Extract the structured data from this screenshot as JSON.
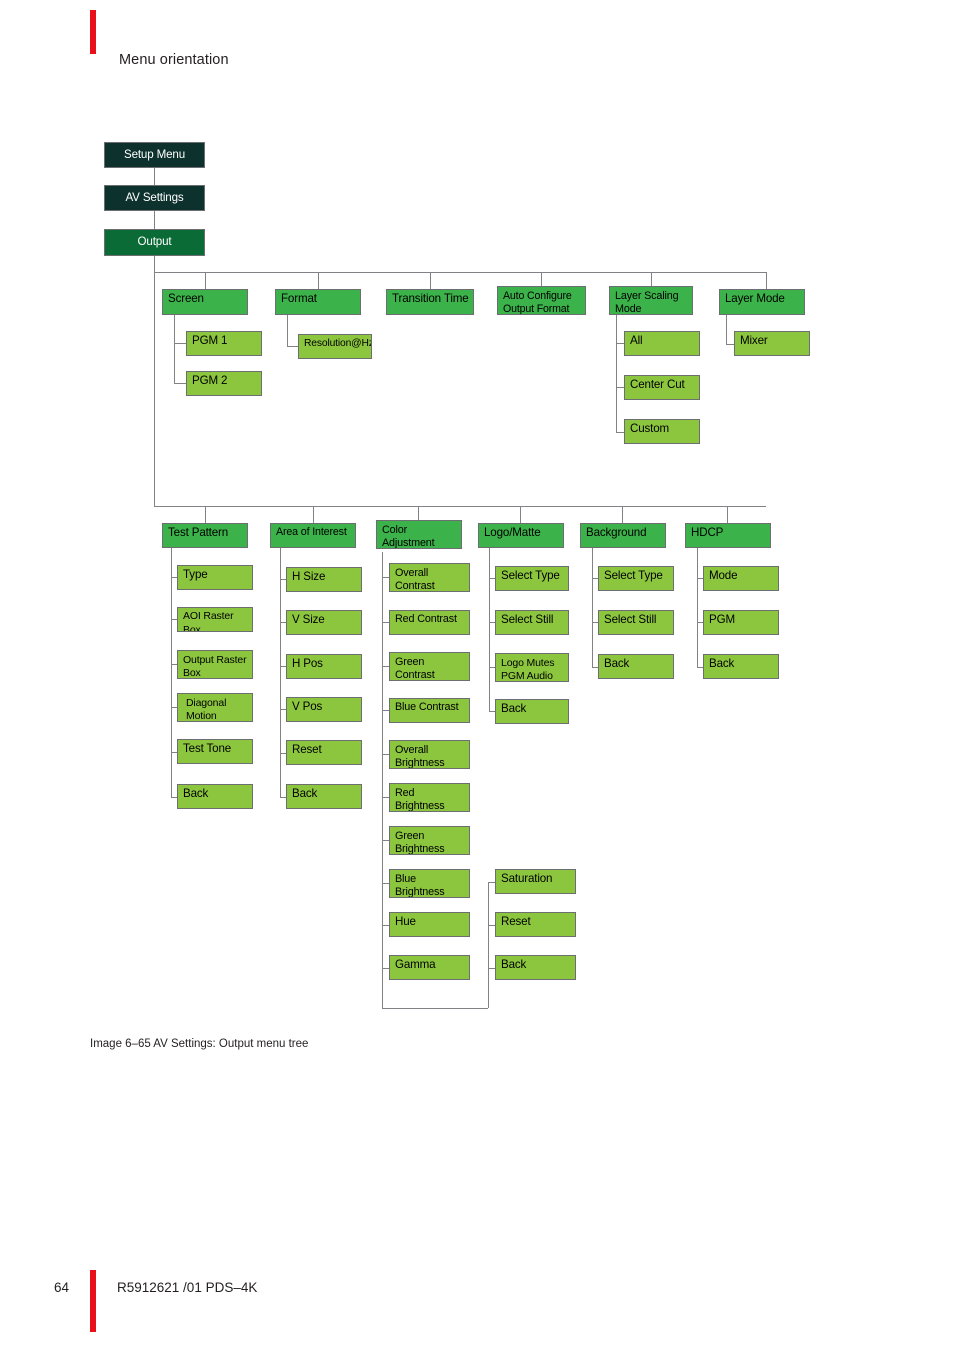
{
  "page": {
    "header_title": "Menu orientation",
    "figure_caption": "Image 6–65  AV Settings: Output menu tree",
    "footer_page_number": "64",
    "footer_document": "R5912621 /01  PDS–4K",
    "accent_color": "#e8111a"
  },
  "palette": {
    "dark": "#0d322e",
    "deep": "#0a6b36",
    "mid": "#3cb24a",
    "light": "#8cc63f",
    "line": "#808285",
    "border": "#6d6e71"
  },
  "nodes": {
    "setup_menu": "Setup Menu",
    "av_settings": "AV Settings",
    "output": "Output",
    "screen": "Screen",
    "pgm1": "PGM 1",
    "pgm2": "PGM 2",
    "format": "Format",
    "resolution": "Resolution@Hz",
    "transition_time": "Transition Time",
    "auto_configure": "Auto Configure\nOutput Format",
    "layer_scaling_mode": "Layer Scaling\nMode",
    "all": "All",
    "center_cut": "Center Cut",
    "custom": "Custom",
    "layer_mode": "Layer Mode",
    "mixer": "Mixer",
    "test_pattern": "Test Pattern",
    "tp_type": "Type",
    "tp_aoi_raster_box": "AOI Raster Box",
    "tp_output_raster_box": "Output Raster\nBox",
    "tp_diagonal_motion": "Diagonal\nMotion",
    "tp_test_tone": "Test Tone",
    "tp_back": "Back",
    "area_of_interest": "Area of Interest",
    "aoi_h_size": "H Size",
    "aoi_v_size": "V Size",
    "aoi_h_pos": "H Pos",
    "aoi_v_pos": "V Pos",
    "aoi_reset": "Reset",
    "aoi_back": "Back",
    "color_adjustment": "Color\nAdjustment",
    "ca_overall_contrast": "Overall\nContrast",
    "ca_red_contrast": "Red Contrast",
    "ca_green_contrast": "Green\nContrast",
    "ca_blue_contrast": "Blue Contrast",
    "ca_overall_brightness": "Overall\nBrightness",
    "ca_red_brightness": "Red\nBrightness",
    "ca_green_brightness": "Green\nBrightness",
    "ca_blue_brightness": "Blue\nBrightness",
    "ca_hue": "Hue",
    "ca_gamma": "Gamma",
    "ca_saturation": "Saturation",
    "ca_reset": "Reset",
    "ca_back": "Back",
    "logo_matte": "Logo/Matte",
    "lm_select_type": "Select Type",
    "lm_select_still": "Select Still",
    "lm_logo_mutes": "Logo Mutes\nPGM Audio",
    "lm_back": "Back",
    "background": "Background",
    "bg_select_type": "Select Type",
    "bg_select_still": "Select Still",
    "bg_back": "Back",
    "hdcp": "HDCP",
    "hdcp_mode": "Mode",
    "hdcp_pgm": "PGM",
    "hdcp_back": "Back"
  }
}
